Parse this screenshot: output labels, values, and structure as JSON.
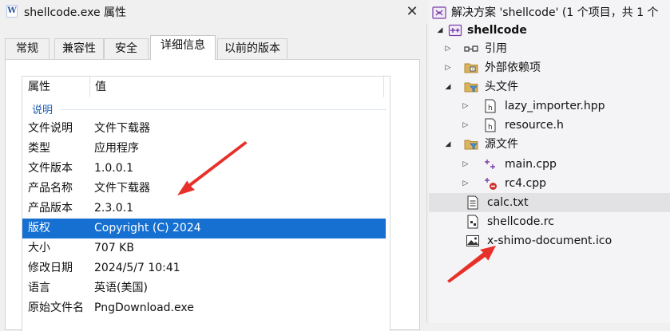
{
  "dialog": {
    "title": "shellcode.exe 属性",
    "app_icon_letter": "W",
    "close_glyph": "✕",
    "tabs": [
      "常规",
      "兼容性",
      "安全",
      "详细信息",
      "以前的版本"
    ],
    "active_tab": "详细信息",
    "columns": {
      "property": "属性",
      "value": "值"
    },
    "group_label": "说明",
    "rows": [
      {
        "key": "文件说明",
        "value": "文件下载器"
      },
      {
        "key": "类型",
        "value": "应用程序"
      },
      {
        "key": "文件版本",
        "value": "1.0.0.1"
      },
      {
        "key": "产品名称",
        "value": "文件下载器"
      },
      {
        "key": "产品版本",
        "value": "2.3.0.1"
      },
      {
        "key": "版权",
        "value": "Copyright (C) 2024"
      },
      {
        "key": "大小",
        "value": "707 KB"
      },
      {
        "key": "修改日期",
        "value": "2024/5/7 10:41"
      },
      {
        "key": "语言",
        "value": "英语(美国)"
      },
      {
        "key": "原始文件名",
        "value": "PngDownload.exe"
      }
    ],
    "selected_row": "版权"
  },
  "explorer": {
    "solution": "解决方案 'shellcode' (1 个项目，共 1 个",
    "project": "shellcode",
    "references": "引用",
    "external_deps": "外部依赖项",
    "header_files": "头文件",
    "headers": [
      "lazy_importer.hpp",
      "resource.h"
    ],
    "source_files": "源文件",
    "sources": [
      "main.cpp",
      "rc4.cpp"
    ],
    "files": [
      "calc.txt",
      "shellcode.rc",
      "x-shimo-document.ico"
    ],
    "selected_item": "calc.txt"
  },
  "colors": {
    "selection_blue": "#1570d2",
    "group_blue": "#1e5fb4",
    "annotation_red": "#e8302a",
    "vs_purple": "#7b3fa8",
    "folder_yellow": "#dcb35c"
  }
}
